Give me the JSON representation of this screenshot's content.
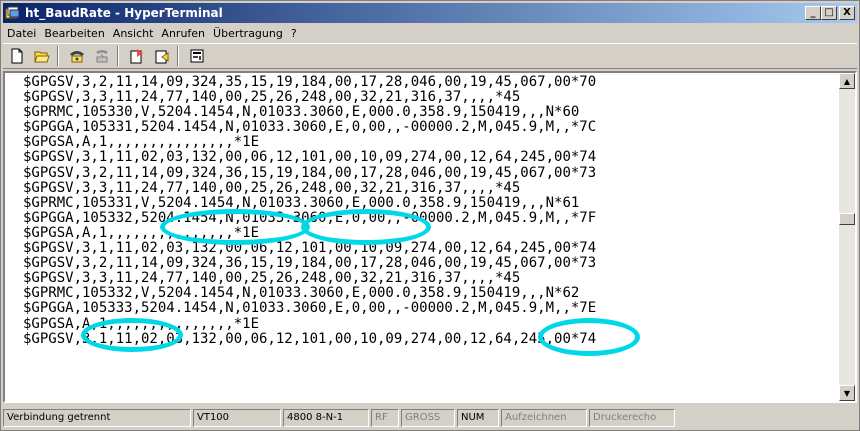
{
  "window": {
    "title": "ht_BaudRate - HyperTerminal",
    "minimize_label": "_",
    "maximize_label": "□",
    "close_label": "X"
  },
  "menu": [
    {
      "label": "Datei"
    },
    {
      "label": "Bearbeiten"
    },
    {
      "label": "Ansicht"
    },
    {
      "label": "Anrufen"
    },
    {
      "label": "Übertragung"
    },
    {
      "label": "?"
    }
  ],
  "toolbar": {
    "buttons": [
      "new-icon",
      "open-icon",
      "connect-icon",
      "disconnect-icon",
      "send-icon",
      "receive-icon",
      "properties-icon"
    ]
  },
  "terminal": {
    "lines": [
      "$GPGSV,3,2,11,14,09,324,35,15,19,184,00,17,28,046,00,19,45,067,00*70",
      "$GPGSV,3,3,11,24,77,140,00,25,26,248,00,32,21,316,37,,,,*45",
      "$GPRMC,105330,V,5204.1454,N,01033.3060,E,000.0,358.9,150419,,,N*60",
      "$GPGGA,105331,5204.1454,N,01033.3060,E,0,00,,-00000.2,M,045.9,M,,*7C",
      "$GPGSA,A,1,,,,,,,,,,,,,,,*1E",
      "$GPGSV,3,1,11,02,03,132,00,06,12,101,00,10,09,274,00,12,64,245,00*74",
      "$GPGSV,3,2,11,14,09,324,36,15,19,184,00,17,28,046,00,19,45,067,00*73",
      "$GPGSV,3,3,11,24,77,140,00,25,26,248,00,32,21,316,37,,,,*45",
      "$GPRMC,105331,V,5204.1454,N,01033.3060,E,000.0,358.9,150419,,,N*61",
      "$GPGGA,105332,5204.1454,N,01033.3060,E,0,00,,-00000.2,M,045.9,M,,*7F",
      "$GPGSA,A,1,,,,,,,,,,,,,,,*1E",
      "$GPGSV,3,1,11,02,03,132,00,06,12,101,00,10,09,274,00,12,64,245,00*74",
      "$GPGSV,3,2,11,14,09,324,36,15,19,184,00,17,28,046,00,19,45,067,00*73",
      "$GPGSV,3,3,11,24,77,140,00,25,26,248,00,32,21,316,37,,,,*45",
      "$GPRMC,105332,V,5204.1454,N,01033.3060,E,000.0,358.9,150419,,,N*62",
      "$GPGGA,105333,5204.1454,N,01033.3060,E,0,00,,-00000.2,M,045.9,M,,*7E",
      "$GPGSA,A,1,,,,,,,,,,,,,,,*1E",
      "$GPGSV,3,1,11,02,03,132,00,06,12,101,00,10,09,274,00,12,64,245,00*74"
    ],
    "highlight_color": "#00d8e8"
  },
  "status": {
    "connection": "Verbindung getrennt",
    "emulation": "VT100",
    "settings": "4800 8-N-1",
    "scroll": "RF",
    "caps": "GROSS",
    "num": "NUM",
    "capture": "Aufzeichnen",
    "print_echo": "Druckerecho"
  }
}
